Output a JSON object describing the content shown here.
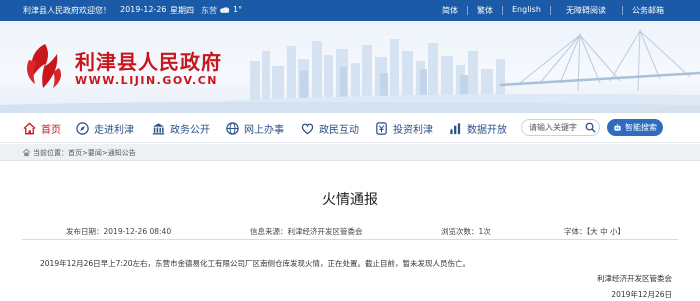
{
  "topbar": {
    "welcome": "利津县人民政府欢迎您！",
    "date": "2019-12-26",
    "weekday": "星期四",
    "city": "东营",
    "weather_icon": "cloud-icon",
    "temperature": "1°",
    "links": [
      "简体",
      "繁体",
      "English",
      "无障碍阅读",
      "公务邮箱"
    ]
  },
  "banner": {
    "site_name": "利津县人民政府",
    "site_url": "WWW.LIJIN.GOV.CN"
  },
  "nav": {
    "items": [
      {
        "label": "首页",
        "icon": "home-icon"
      },
      {
        "label": "走进利津",
        "icon": "compass-icon"
      },
      {
        "label": "政务公开",
        "icon": "building-icon"
      },
      {
        "label": "网上办事",
        "icon": "globe-icon"
      },
      {
        "label": "政民互动",
        "icon": "heart-icon"
      },
      {
        "label": "投资利津",
        "icon": "coin-icon"
      },
      {
        "label": "数据开放",
        "icon": "bar-chart-icon"
      }
    ],
    "search_placeholder": "请输入关键字",
    "smart_search": "智能搜索"
  },
  "breadcrumb": {
    "prefix": "当前位置：",
    "items": [
      "首页",
      "要闻",
      "通知公告"
    ],
    "separator": ">"
  },
  "article": {
    "title": "火情通报",
    "publish_label": "发布日期：",
    "publish_date": "2019-12-26 08:40",
    "source_label": "信息来源：",
    "source": "利津经济开发区管委会",
    "views_label": "浏览次数：",
    "views": "1次",
    "font_label": "字体：",
    "font_sizes": [
      "大",
      "中",
      "小"
    ],
    "paragraph": "2019年12月26日早上7:20左右，东营市金德易化工有限公司厂区南侧仓库发现火情，正在处置。截止目前，暂未发现人员伤亡。",
    "signature_org": "利津经济开发区管委会",
    "signature_date": "2019年12月26日"
  },
  "colors": {
    "topbar_bg": "#1a5aa6",
    "brand_red": "#c8161d",
    "nav_text": "#2b4f8a",
    "button_blue": "#2f6cc0"
  }
}
